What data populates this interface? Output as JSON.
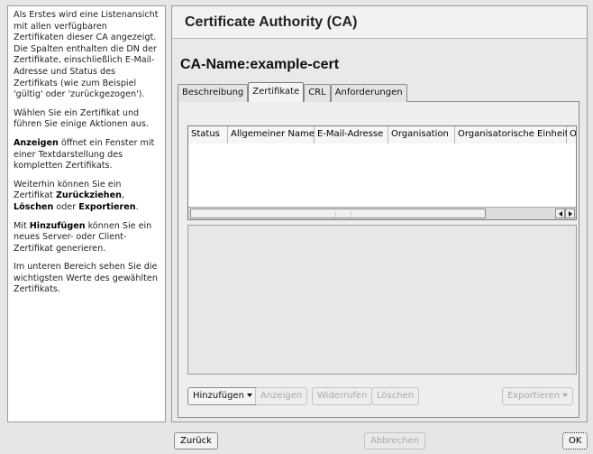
{
  "help": {
    "p1": "Als Erstes wird eine Listenansicht mit allen verfügbaren Zertifikaten dieser CA angezeigt. Die Spalten enthalten die DN der Zertifikate, einschließlich E-Mail-Adresse und Status des Zertifikats (wie zum Beispiel 'gültig' oder 'zurückgezogen').",
    "p2": "Wählen Sie ein Zertifikat und führen Sie einige Aktionen aus.",
    "p3_bold": "Anzeigen",
    "p3_rest": " öffnet ein Fenster mit einer Textdarstellung des kompletten Zertifikats.",
    "p4_a": "Weiterhin können Sie ein Zertifikat ",
    "p4_b1": "Zurückziehen",
    "p4_sep": ", ",
    "p4_b2": "Löschen",
    "p4_or": " oder ",
    "p4_b3": "Exportieren",
    "p4_end": ".",
    "p5_a": "Mit ",
    "p5_b": "Hinzufügen",
    "p5_rest": " können Sie ein neues Server- oder Client-Zertifikat generieren.",
    "p6": "Im unteren Bereich sehen Sie die wichtigsten Werte des gewählten Zertifikats."
  },
  "main": {
    "title": "Certificate Authority (CA)",
    "ca_name": "CA-Name:example-cert",
    "tabs": [
      {
        "label": "Beschreibung"
      },
      {
        "label": "Zertifikate"
      },
      {
        "label": "CRL"
      },
      {
        "label": "Anforderungen"
      }
    ],
    "active_tab": "Zertifikate",
    "columns": [
      "Status",
      "Allgemeiner Name",
      "E-Mail-Adresse",
      "Organisation",
      "Organisatorische Einheit",
      "Or"
    ],
    "buttons": {
      "add": "Hinzufügen",
      "view": "Anzeigen",
      "revoke": "Widerrufen",
      "delete": "Löschen",
      "export": "Exportieren"
    }
  },
  "footer": {
    "back": "Zurück",
    "cancel": "Abbrechen",
    "ok": "OK"
  }
}
